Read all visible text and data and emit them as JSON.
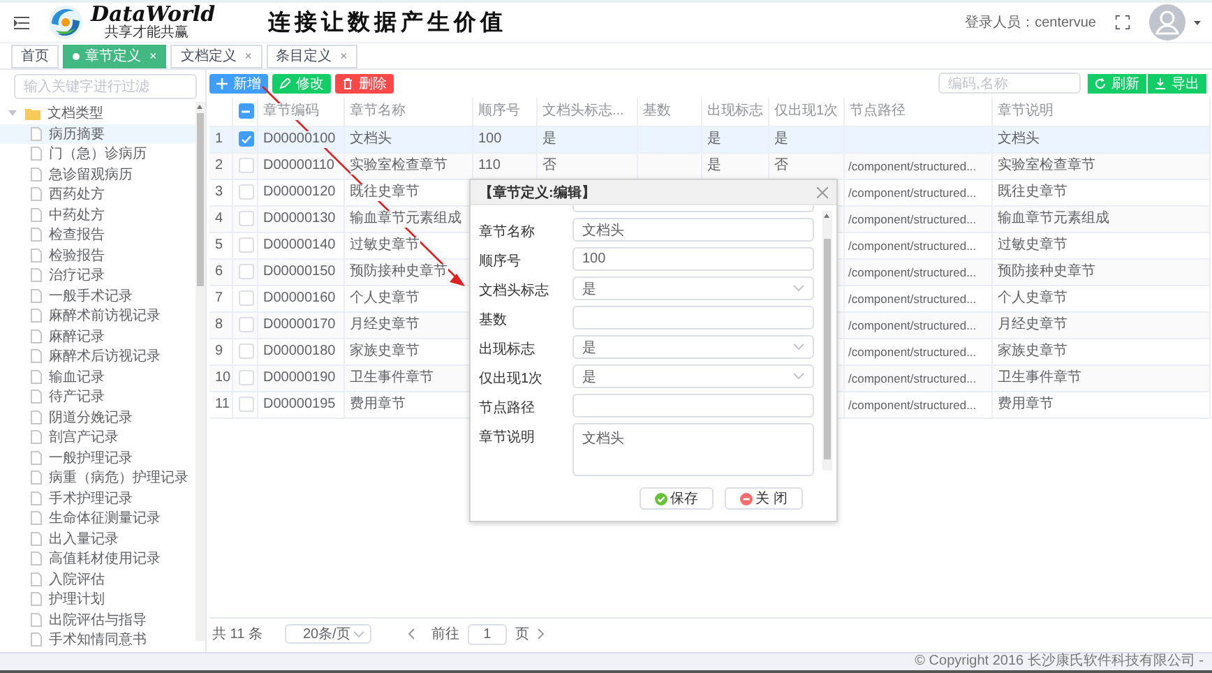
{
  "header": {
    "brand": "DataWorld",
    "tagline": "共享才能共赢",
    "slogan": "连接让数据产生价值",
    "user_label": "登录人员：centervue"
  },
  "tabs": [
    {
      "label": "首页",
      "selected": false
    },
    {
      "label": "章节定义",
      "close": "×",
      "selected": true
    },
    {
      "label": "文档定义",
      "close": "×",
      "selected": false
    },
    {
      "label": "条目定义",
      "close": "×",
      "selected": false
    }
  ],
  "sidebar": {
    "filter_placeholder": "输入关键字进行过滤",
    "tree": [
      {
        "label": "文档类型",
        "expanded": true,
        "children": [
          {
            "label": "病历摘要",
            "selected": true
          },
          {
            "label": "门（急）诊病历",
            "selected": false
          },
          {
            "label": "急诊留观病历",
            "selected": false
          },
          {
            "label": "西药处方",
            "selected": false
          },
          {
            "label": "中药处方",
            "selected": false
          },
          {
            "label": "检查报告",
            "selected": false
          },
          {
            "label": "检验报告",
            "selected": false
          },
          {
            "label": "治疗记录",
            "selected": false
          },
          {
            "label": "一般手术记录",
            "selected": false
          },
          {
            "label": "麻醉术前访视记录",
            "selected": false
          },
          {
            "label": "麻醉记录",
            "selected": false
          },
          {
            "label": "麻醉术后访视记录",
            "selected": false
          },
          {
            "label": "输血记录",
            "selected": false
          },
          {
            "label": "待产记录",
            "selected": false
          },
          {
            "label": "阴道分娩记录",
            "selected": false
          },
          {
            "label": "剖宫产记录",
            "selected": false
          },
          {
            "label": "一般护理记录",
            "selected": false
          },
          {
            "label": "病重（病危）护理记录",
            "selected": false
          },
          {
            "label": "手术护理记录",
            "selected": false
          },
          {
            "label": "生命体征测量记录",
            "selected": false
          },
          {
            "label": "出入量记录",
            "selected": false
          },
          {
            "label": "高值耗材使用记录",
            "selected": false
          },
          {
            "label": "入院评估",
            "selected": false
          },
          {
            "label": "护理计划",
            "selected": false
          },
          {
            "label": "出院评估与指导",
            "selected": false
          },
          {
            "label": "手术知情同意书",
            "selected": false
          }
        ]
      }
    ]
  },
  "toolbar": {
    "buttons": [
      {
        "label": "新增",
        "kind": "add"
      },
      {
        "label": "修改",
        "kind": "edit"
      },
      {
        "label": "删除",
        "kind": "delete"
      }
    ],
    "search_placeholder": "编码,名称",
    "right_buttons": [
      {
        "label": "刷新",
        "kind": "refresh"
      },
      {
        "label": "导出",
        "kind": "export"
      }
    ]
  },
  "table": {
    "select_all": {
      "indeterminate": true
    },
    "columns": [
      "章节编码",
      "章节名称",
      "顺序号",
      "文档头标志...",
      "基数",
      "出现标志",
      "仅出现1次",
      "节点路径",
      "章节说明"
    ],
    "rows": [
      {
        "index": "1",
        "checked": true,
        "selected": true,
        "code": "D00000100",
        "name": "文档头",
        "order": "100",
        "header_flag": "是",
        "appear_flag": "是",
        "once": "是",
        "description": "文档头"
      },
      {
        "index": "2",
        "checked": false,
        "selected": false,
        "code": "D00000110",
        "name": "实验室检查章节",
        "order": "110",
        "header_flag": "否",
        "appear_flag": "是",
        "once": "否",
        "node_path": "/component/structured...",
        "description": "实验室检查章节"
      },
      {
        "index": "3",
        "checked": false,
        "selected": false,
        "code": "D00000120",
        "name": "既往史章节",
        "node_path": "/component/structured...",
        "description": "既往史章节"
      },
      {
        "index": "4",
        "checked": false,
        "selected": false,
        "code": "D00000130",
        "name": "输血章节元素组成",
        "node_path": "/component/structured...",
        "description": "输血章节元素组成"
      },
      {
        "index": "5",
        "checked": false,
        "selected": false,
        "code": "D00000140",
        "name": "过敏史章节",
        "node_path": "/component/structured...",
        "description": "过敏史章节"
      },
      {
        "index": "6",
        "checked": false,
        "selected": false,
        "code": "D00000150",
        "name": "预防接种史章节",
        "node_path": "/component/structured...",
        "description": "预防接种史章节"
      },
      {
        "index": "7",
        "checked": false,
        "selected": false,
        "code": "D00000160",
        "name": "个人史章节",
        "node_path": "/component/structured...",
        "description": "个人史章节"
      },
      {
        "index": "8",
        "checked": false,
        "selected": false,
        "code": "D00000170",
        "name": "月经史章节",
        "node_path": "/component/structured...",
        "description": "月经史章节"
      },
      {
        "index": "9",
        "checked": false,
        "selected": false,
        "code": "D00000180",
        "name": "家族史章节",
        "node_path": "/component/structured...",
        "description": "家族史章节"
      },
      {
        "index": "10",
        "checked": false,
        "selected": false,
        "code": "D00000190",
        "name": "卫生事件章节",
        "node_path": "/component/structured...",
        "description": "卫生事件章节"
      },
      {
        "index": "11",
        "checked": false,
        "selected": false,
        "code": "D00000195",
        "name": "费用章节",
        "node_path": "/component/structured...",
        "description": "费用章节"
      }
    ]
  },
  "pagination": {
    "total": "共 11 条",
    "page_size": "20条/页",
    "goto_label": "前往",
    "page": "1",
    "page_suffix": "页"
  },
  "dialog": {
    "title": "【章节定义:编辑】",
    "fields": [
      {
        "label": "章节名称",
        "kind": "text",
        "value": "文档头"
      },
      {
        "label": "顺序号",
        "kind": "text",
        "value": "100"
      },
      {
        "label": "文档头标志",
        "kind": "select",
        "value": "是"
      },
      {
        "label": "基数",
        "kind": "text"
      },
      {
        "label": "出现标志",
        "kind": "select",
        "value": "是"
      },
      {
        "label": "仅出现1次",
        "kind": "select",
        "value": "是"
      },
      {
        "label": "节点路径",
        "kind": "text"
      },
      {
        "label": "章节说明",
        "kind": "textarea",
        "value": "文档头"
      }
    ],
    "buttons": [
      {
        "label": "保存",
        "kind": "save"
      },
      {
        "label": "关 闭",
        "kind": "close"
      }
    ]
  },
  "footer": {
    "copyright": "© Copyright 2016 长沙康氏软件科技有限公司 -"
  }
}
